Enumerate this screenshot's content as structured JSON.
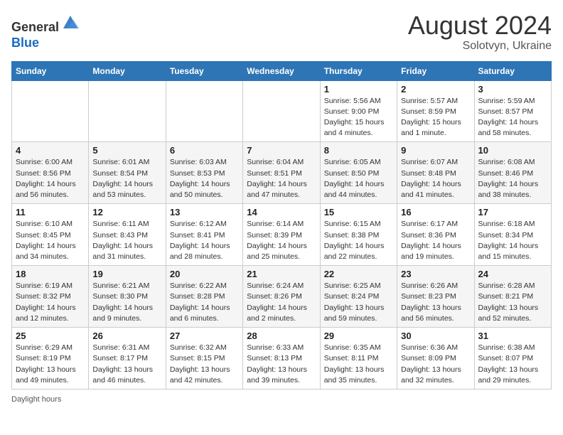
{
  "header": {
    "logo_line1": "General",
    "logo_line2": "Blue",
    "month_year": "August 2024",
    "location": "Solotvyn, Ukraine"
  },
  "days_of_week": [
    "Sunday",
    "Monday",
    "Tuesday",
    "Wednesday",
    "Thursday",
    "Friday",
    "Saturday"
  ],
  "weeks": [
    [
      {
        "day": "",
        "detail": ""
      },
      {
        "day": "",
        "detail": ""
      },
      {
        "day": "",
        "detail": ""
      },
      {
        "day": "",
        "detail": ""
      },
      {
        "day": "1",
        "detail": "Sunrise: 5:56 AM\nSunset: 9:00 PM\nDaylight: 15 hours and 4 minutes."
      },
      {
        "day": "2",
        "detail": "Sunrise: 5:57 AM\nSunset: 8:59 PM\nDaylight: 15 hours and 1 minute."
      },
      {
        "day": "3",
        "detail": "Sunrise: 5:59 AM\nSunset: 8:57 PM\nDaylight: 14 hours and 58 minutes."
      }
    ],
    [
      {
        "day": "4",
        "detail": "Sunrise: 6:00 AM\nSunset: 8:56 PM\nDaylight: 14 hours and 56 minutes."
      },
      {
        "day": "5",
        "detail": "Sunrise: 6:01 AM\nSunset: 8:54 PM\nDaylight: 14 hours and 53 minutes."
      },
      {
        "day": "6",
        "detail": "Sunrise: 6:03 AM\nSunset: 8:53 PM\nDaylight: 14 hours and 50 minutes."
      },
      {
        "day": "7",
        "detail": "Sunrise: 6:04 AM\nSunset: 8:51 PM\nDaylight: 14 hours and 47 minutes."
      },
      {
        "day": "8",
        "detail": "Sunrise: 6:05 AM\nSunset: 8:50 PM\nDaylight: 14 hours and 44 minutes."
      },
      {
        "day": "9",
        "detail": "Sunrise: 6:07 AM\nSunset: 8:48 PM\nDaylight: 14 hours and 41 minutes."
      },
      {
        "day": "10",
        "detail": "Sunrise: 6:08 AM\nSunset: 8:46 PM\nDaylight: 14 hours and 38 minutes."
      }
    ],
    [
      {
        "day": "11",
        "detail": "Sunrise: 6:10 AM\nSunset: 8:45 PM\nDaylight: 14 hours and 34 minutes."
      },
      {
        "day": "12",
        "detail": "Sunrise: 6:11 AM\nSunset: 8:43 PM\nDaylight: 14 hours and 31 minutes."
      },
      {
        "day": "13",
        "detail": "Sunrise: 6:12 AM\nSunset: 8:41 PM\nDaylight: 14 hours and 28 minutes."
      },
      {
        "day": "14",
        "detail": "Sunrise: 6:14 AM\nSunset: 8:39 PM\nDaylight: 14 hours and 25 minutes."
      },
      {
        "day": "15",
        "detail": "Sunrise: 6:15 AM\nSunset: 8:38 PM\nDaylight: 14 hours and 22 minutes."
      },
      {
        "day": "16",
        "detail": "Sunrise: 6:17 AM\nSunset: 8:36 PM\nDaylight: 14 hours and 19 minutes."
      },
      {
        "day": "17",
        "detail": "Sunrise: 6:18 AM\nSunset: 8:34 PM\nDaylight: 14 hours and 15 minutes."
      }
    ],
    [
      {
        "day": "18",
        "detail": "Sunrise: 6:19 AM\nSunset: 8:32 PM\nDaylight: 14 hours and 12 minutes."
      },
      {
        "day": "19",
        "detail": "Sunrise: 6:21 AM\nSunset: 8:30 PM\nDaylight: 14 hours and 9 minutes."
      },
      {
        "day": "20",
        "detail": "Sunrise: 6:22 AM\nSunset: 8:28 PM\nDaylight: 14 hours and 6 minutes."
      },
      {
        "day": "21",
        "detail": "Sunrise: 6:24 AM\nSunset: 8:26 PM\nDaylight: 14 hours and 2 minutes."
      },
      {
        "day": "22",
        "detail": "Sunrise: 6:25 AM\nSunset: 8:24 PM\nDaylight: 13 hours and 59 minutes."
      },
      {
        "day": "23",
        "detail": "Sunrise: 6:26 AM\nSunset: 8:23 PM\nDaylight: 13 hours and 56 minutes."
      },
      {
        "day": "24",
        "detail": "Sunrise: 6:28 AM\nSunset: 8:21 PM\nDaylight: 13 hours and 52 minutes."
      }
    ],
    [
      {
        "day": "25",
        "detail": "Sunrise: 6:29 AM\nSunset: 8:19 PM\nDaylight: 13 hours and 49 minutes."
      },
      {
        "day": "26",
        "detail": "Sunrise: 6:31 AM\nSunset: 8:17 PM\nDaylight: 13 hours and 46 minutes."
      },
      {
        "day": "27",
        "detail": "Sunrise: 6:32 AM\nSunset: 8:15 PM\nDaylight: 13 hours and 42 minutes."
      },
      {
        "day": "28",
        "detail": "Sunrise: 6:33 AM\nSunset: 8:13 PM\nDaylight: 13 hours and 39 minutes."
      },
      {
        "day": "29",
        "detail": "Sunrise: 6:35 AM\nSunset: 8:11 PM\nDaylight: 13 hours and 35 minutes."
      },
      {
        "day": "30",
        "detail": "Sunrise: 6:36 AM\nSunset: 8:09 PM\nDaylight: 13 hours and 32 minutes."
      },
      {
        "day": "31",
        "detail": "Sunrise: 6:38 AM\nSunset: 8:07 PM\nDaylight: 13 hours and 29 minutes."
      }
    ]
  ],
  "footer": {
    "note": "Daylight hours"
  }
}
